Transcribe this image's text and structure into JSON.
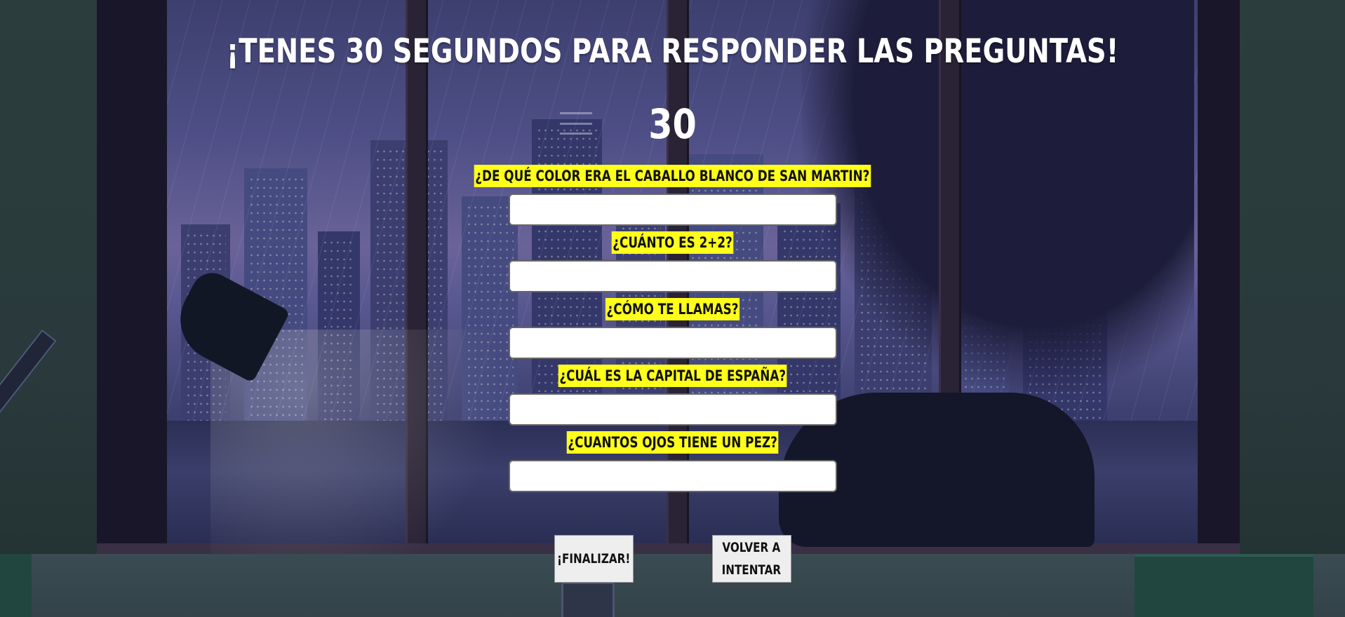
{
  "page": {
    "title": "¡TENES 30 SEGUNDOS PARA RESPONDER LAS PREGUNTAS!",
    "timer": "30"
  },
  "questions": [
    {
      "label": "¿DE QUÉ COLOR ERA EL CABALLO BLANCO DE SAN MARTIN?",
      "value": ""
    },
    {
      "label": "¿CUÁNTO ES 2+2?",
      "value": ""
    },
    {
      "label": "¿CÓMO TE LLAMAS?",
      "value": ""
    },
    {
      "label": "¿CUÁL ES LA CAPITAL DE ESPAÑA?",
      "value": ""
    },
    {
      "label": "¿CUANTOS OJOS TIENE UN PEZ?",
      "value": ""
    }
  ],
  "buttons": {
    "finish_label": "¡FINALIZAR!",
    "retry_label": "VOLVER A INTENTAR"
  },
  "icons": {
    "menu": "hamburger-menu-icon"
  },
  "colors": {
    "question_highlight": "#ffff1a",
    "title_text": "#ffffff"
  }
}
